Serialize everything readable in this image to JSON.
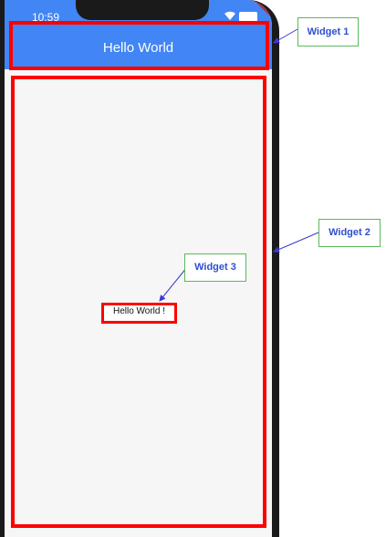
{
  "status_bar": {
    "time": "10:59"
  },
  "app_bar": {
    "title": "Hello World"
  },
  "body": {
    "text": "Hello World !"
  },
  "annotations": [
    {
      "label": "Widget 1"
    },
    {
      "label": "Widget 2"
    },
    {
      "label": "Widget 3"
    }
  ],
  "colors": {
    "app_bar": "#4285f4",
    "highlight": "#ff0000",
    "callout_border": "#5cb85c",
    "callout_text": "#2f4fd1"
  }
}
